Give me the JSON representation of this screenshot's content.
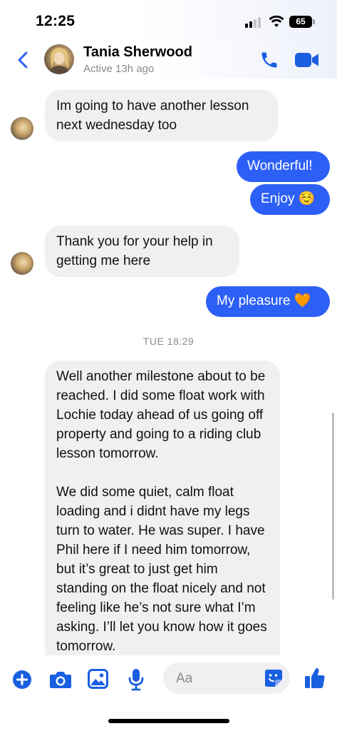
{
  "status_bar": {
    "time": "12:25",
    "battery": "65"
  },
  "header": {
    "contact_name": "Tania Sherwood",
    "contact_status": "Active 13h ago"
  },
  "messages": [
    {
      "direction": "in",
      "text_line1": "Im going to have another lesson",
      "text_line2": "next wednesday too"
    },
    {
      "direction": "out",
      "text": "Wonderful!"
    },
    {
      "direction": "out",
      "text": "Enjoy ☺️"
    },
    {
      "direction": "in",
      "text_line1": "Thank you for your help in",
      "text_line2": "getting me here"
    },
    {
      "direction": "out",
      "text": "My pleasure 🧡"
    }
  ],
  "timestamp": "TUE 18:29",
  "long_message": {
    "paragraph1": "Well another milestone about to be reached. I did some float work with Lochie today ahead of us going off property and going to a riding club lesson tomorrow.",
    "paragraph2": "We did some quiet, calm float loading and i didnt have my legs turn to water. He was super. I have Phil here if I need him tomorrow, but it’s great to just get him standing on the float nicely and not feeling like he’s not sure what I’m asking. I’ll let you know how it goes tomorrow."
  },
  "composer": {
    "placeholder": "Aa"
  },
  "colors": {
    "accent": "#2c5ff6",
    "incoming_bubble": "#f0f0f2",
    "messenger_blue": "#1a5fe0"
  }
}
